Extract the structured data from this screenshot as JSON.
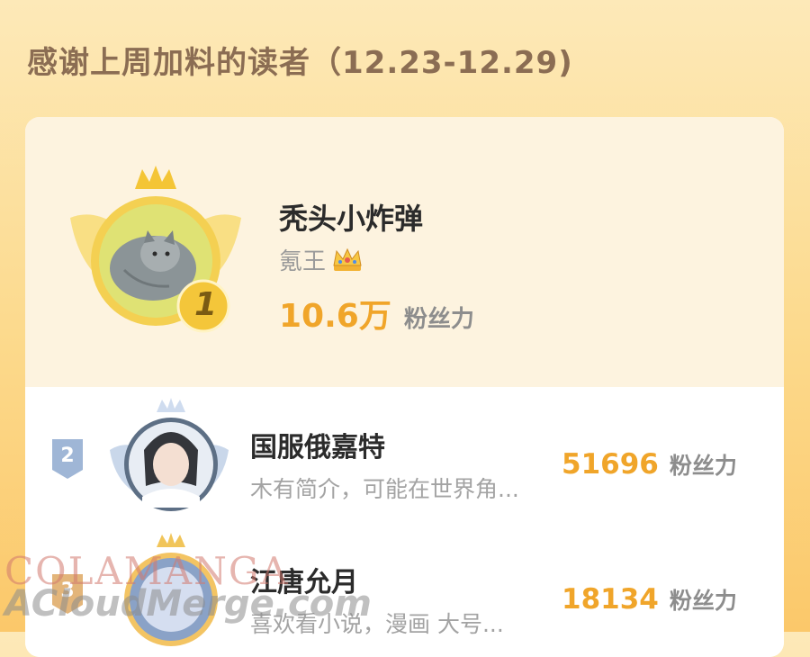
{
  "header": {
    "title": "感谢上周加料的读者（12.23-12.29)"
  },
  "top_reader": {
    "rank": "1",
    "name": "秃头小炸弹",
    "title": "氪王",
    "title_badge_icon": "crown-icon",
    "score": "10.6万",
    "score_unit": "粉丝力"
  },
  "readers": [
    {
      "rank": "2",
      "name": "国服俄嘉特",
      "desc": "木有简介，可能在世界角...",
      "score": "51696",
      "score_unit": "粉丝力"
    },
    {
      "rank": "3",
      "name": "江唐允月",
      "desc": "喜欢看小说，漫画 大号...",
      "score": "18134",
      "score_unit": "粉丝力"
    }
  ],
  "watermarks": {
    "line1": "COLAMANGA",
    "line2": "ACloudMerge.com"
  },
  "colors": {
    "accent": "#f0a52a",
    "gold": "#f3c743",
    "silver": "#8aa6c8"
  }
}
